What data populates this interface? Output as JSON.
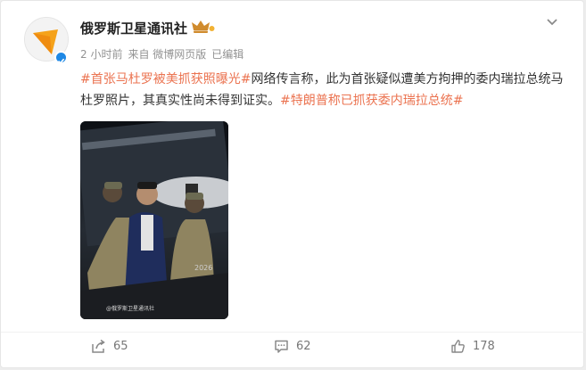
{
  "user": {
    "name": "俄罗斯卫星通讯社",
    "meta": [
      "2 小时前",
      "来自 微博网页版",
      "已编辑"
    ]
  },
  "post": {
    "topic1": "#首张马杜罗被美抓获照曝光#",
    "text1": "网络传言称，此为首张疑似遭美方拘押的委内瑞拉总统马杜罗照片，其真实性尚未得到证实。",
    "topic2": "#特朗普称已抓获委内瑞拉总统#",
    "image_watermark": "@俄罗斯卫星通讯社",
    "image_number": "2026"
  },
  "actions": {
    "repost": "65",
    "comment": "62",
    "like": "178"
  },
  "colors": {
    "topic": "#eb7350",
    "verified": "#1e88e5"
  },
  "icons": [
    "chevron-down-icon",
    "crown-icon",
    "verified-icon",
    "repost-icon",
    "comment-icon",
    "like-icon"
  ]
}
